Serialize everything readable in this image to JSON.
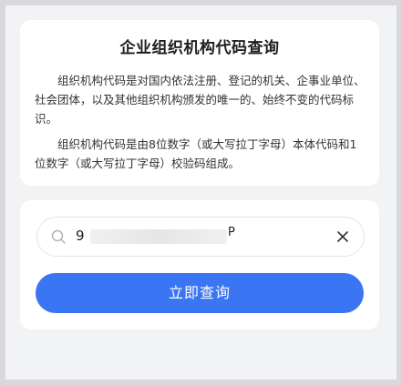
{
  "info": {
    "title": "企业组织机构代码查询",
    "paragraph1": "组织机构代码是对国内依法注册、登记的机关、企事业单位、社会团体，以及其他组织机构颁发的唯一的、始终不变的代码标识。",
    "paragraph2": "组织机构代码是由8位数字（或大写拉丁字母）本体代码和1位数字（或大写拉丁字母）校验码组成。"
  },
  "search": {
    "value_prefix": "9",
    "value_suffix": "P",
    "value_masked": true,
    "search_icon": "search-icon",
    "clear_icon": "close-icon"
  },
  "button": {
    "label": "立即查询",
    "color": "#3a75f3"
  }
}
